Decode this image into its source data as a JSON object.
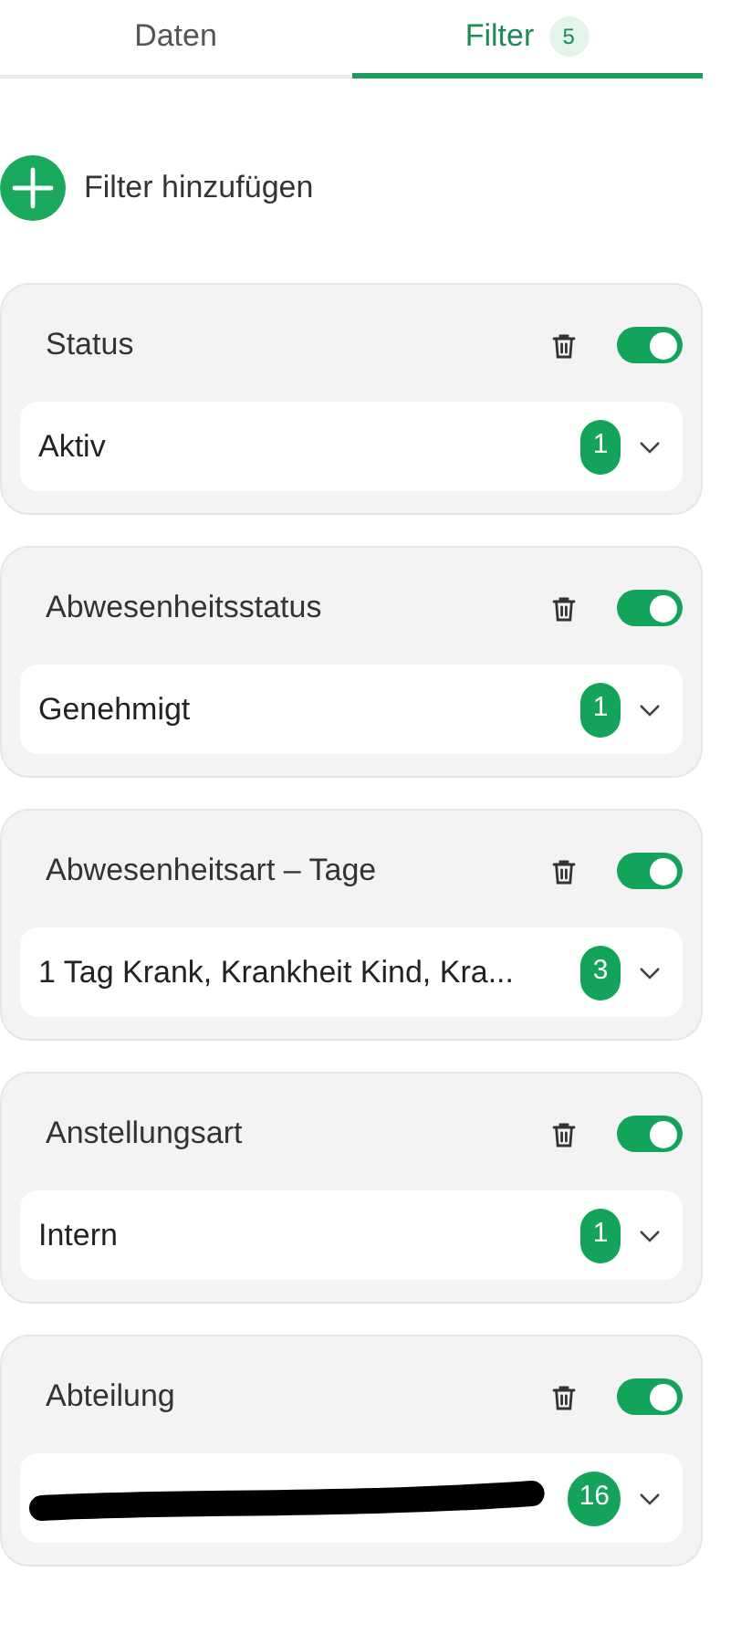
{
  "tabs": [
    {
      "label": "Daten",
      "selected": false
    },
    {
      "label": "Filter",
      "selected": true,
      "badge": "5"
    }
  ],
  "add_filter": {
    "label": "Filter hinzufügen"
  },
  "filters": [
    {
      "title": "Status",
      "on": true,
      "value": "Aktiv",
      "count": "1"
    },
    {
      "title": "Abwesenheitsstatus",
      "on": true,
      "value": "Genehmigt",
      "count": "1"
    },
    {
      "title": "Abwesenheitsart – Tage",
      "on": true,
      "value": "1 Tag Krank, Krankheit Kind, Kra...",
      "count": "3"
    },
    {
      "title": "Anstellungsart",
      "on": true,
      "value": "Intern",
      "count": "1"
    },
    {
      "title": "Abteilung",
      "on": true,
      "redacted": true,
      "count": "16"
    }
  ]
}
